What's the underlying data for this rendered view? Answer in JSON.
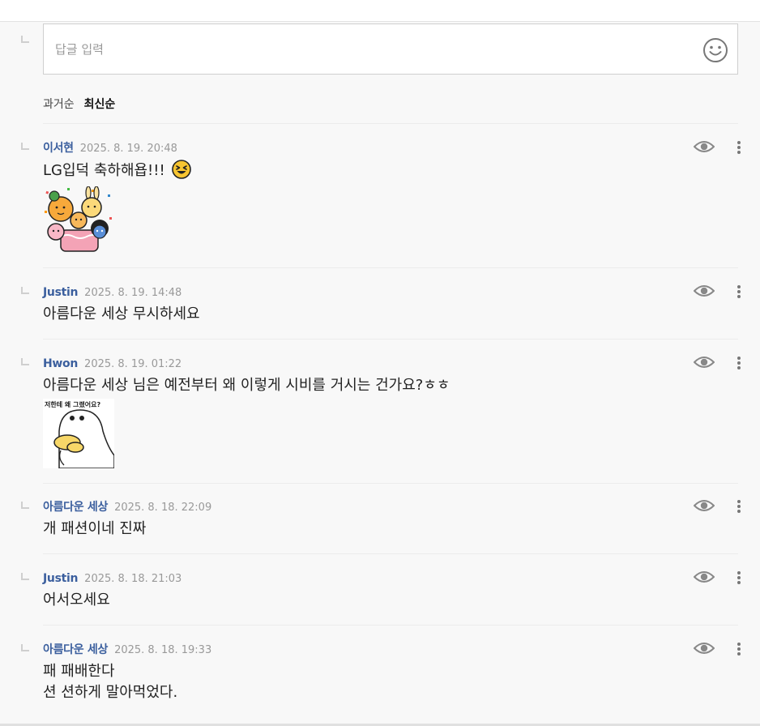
{
  "reply": {
    "placeholder": "답글 입력",
    "emoji_icon": "smiley-face-icon"
  },
  "sort": {
    "options": [
      "과거순",
      "최신순"
    ],
    "selected": "최신순"
  },
  "comments": [
    {
      "author": "이서현",
      "date": "2025. 8. 19. 20:48",
      "text": "LG입덕 축하해욥!!!",
      "inline_emoji": "laughing-face-icon",
      "sticker": "party-characters-sticker"
    },
    {
      "author": "Justin",
      "date": "2025. 8. 19. 14:48",
      "text": "아름다운 세상 무시하세요"
    },
    {
      "author": "Hwon",
      "date": "2025. 8. 19. 01:22",
      "text": "아름다운 세상 님은 예전부터 왜 이렇게 시비를 거시는 건가요?ㅎㅎ",
      "sticker": "duck-sticker",
      "sticker_caption": "저한테 왜 그랬어요?"
    },
    {
      "author": "아름다운 세상",
      "date": "2025. 8. 18. 22:09",
      "text": "개 패션이네 진짜"
    },
    {
      "author": "Justin",
      "date": "2025. 8. 18. 21:03",
      "text": "어서오세요"
    },
    {
      "author": "아름다운 세상",
      "date": "2025. 8. 18. 19:33",
      "text_lines": [
        "패 패배한다",
        "션 션하게 말아먹었다."
      ]
    }
  ],
  "icons": {
    "view": "eye-icon",
    "more": "more-vertical-icon",
    "reply_marker": "reply-corner-icon"
  },
  "colors": {
    "author": "#3b5f9e",
    "date": "#999999",
    "background": "#f8f8f8"
  }
}
